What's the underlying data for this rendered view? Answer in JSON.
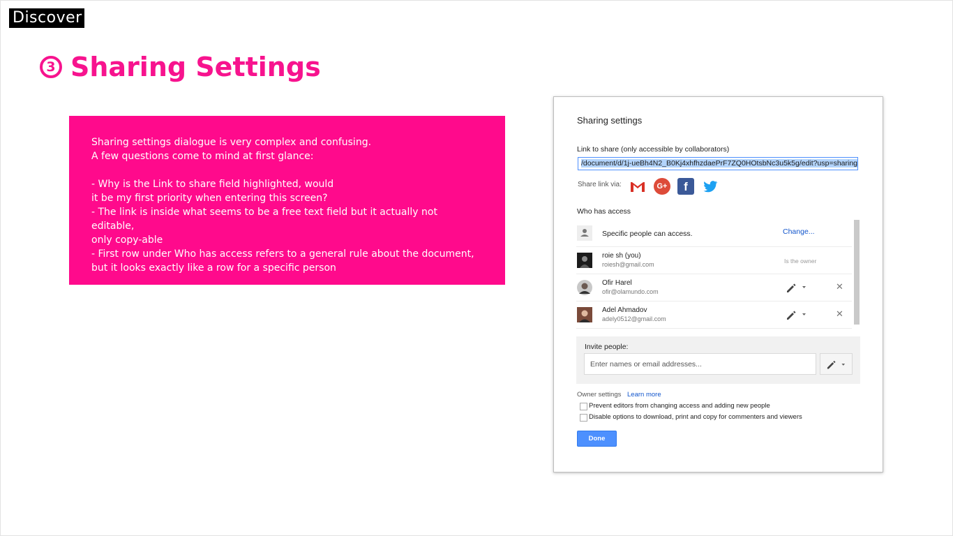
{
  "slide": {
    "section": "Discover",
    "title_number": "3",
    "title": "Sharing Settings",
    "note": "Sharing settings dialogue is very complex and confusing.\nA few questions come to mind at first glance:\n\n- Why is the Link to share field highlighted, would\nit be my first priority when entering this screen?\n- The link is inside what seems to be a free text field but it actually not editable,\nonly copy-able\n- First row under Who has access refers to a general rule about the document,\nbut it looks exactly like a row for a specific person"
  },
  "dialog": {
    "title": "Sharing settings",
    "link_label": "Link to share (only accessible by collaborators)",
    "link_value": "/document/d/1j-ueBh4N2_B0Kj4xhfhzdaePrF7ZQ0HOtsbNc3u5k5g/edit?usp=sharing",
    "share_via_label": "Share link via:",
    "share_icons": [
      "gmail-icon",
      "google-plus-icon",
      "facebook-icon",
      "twitter-icon"
    ],
    "who_has_access_label": "Who has access",
    "access_rule": {
      "text": "Specific people can access.",
      "change_label": "Change..."
    },
    "people": [
      {
        "name": "roie sh (you)",
        "email": "roiesh@gmail.com",
        "role": "Is the owner"
      },
      {
        "name": "Ofir Harel",
        "email": "ofir@olamundo.com"
      },
      {
        "name": "Adel Ahmadov",
        "email": "adely0512@gmail.com"
      }
    ],
    "invite_label": "Invite people:",
    "invite_placeholder": "Enter names or email addresses...",
    "owner_settings_label": "Owner settings",
    "learn_more": "Learn more",
    "options": [
      "Prevent editors from changing access and adding new people",
      "Disable options to download, print and copy for commenters and viewers"
    ],
    "done_label": "Done"
  },
  "colors": {
    "accent_pink": "#f7138e",
    "note_bg": "#ff0a8c",
    "link_blue": "#1155cc",
    "button_blue": "#4d90fe"
  }
}
